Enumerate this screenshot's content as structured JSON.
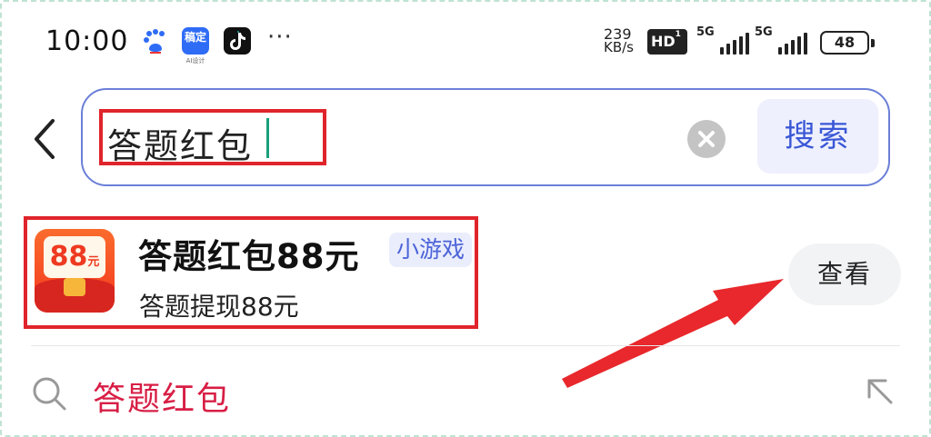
{
  "status_bar": {
    "time": "10:00",
    "gaoding_label": "稿定",
    "gaoding_sub": "AI设计",
    "more": "···",
    "net_speed_value": "239",
    "net_speed_unit": "KB/s",
    "hd_label": "HD",
    "signal1_label": "5G",
    "signal2_label": "5G",
    "battery": "48"
  },
  "search": {
    "query": "答题红包",
    "search_button": "搜索"
  },
  "result": {
    "icon_value": "88",
    "icon_unit": "元",
    "title": "答题红包88元",
    "tag": "小游戏",
    "subtitle": "答题提现88元",
    "view_button": "查看"
  },
  "suggestion": {
    "text": "答题红包"
  },
  "colors": {
    "search_border": "#6b7fd7",
    "search_button_text": "#3a57d6",
    "annotation_red": "#e0242b",
    "suggestion_text": "#d81e45"
  }
}
